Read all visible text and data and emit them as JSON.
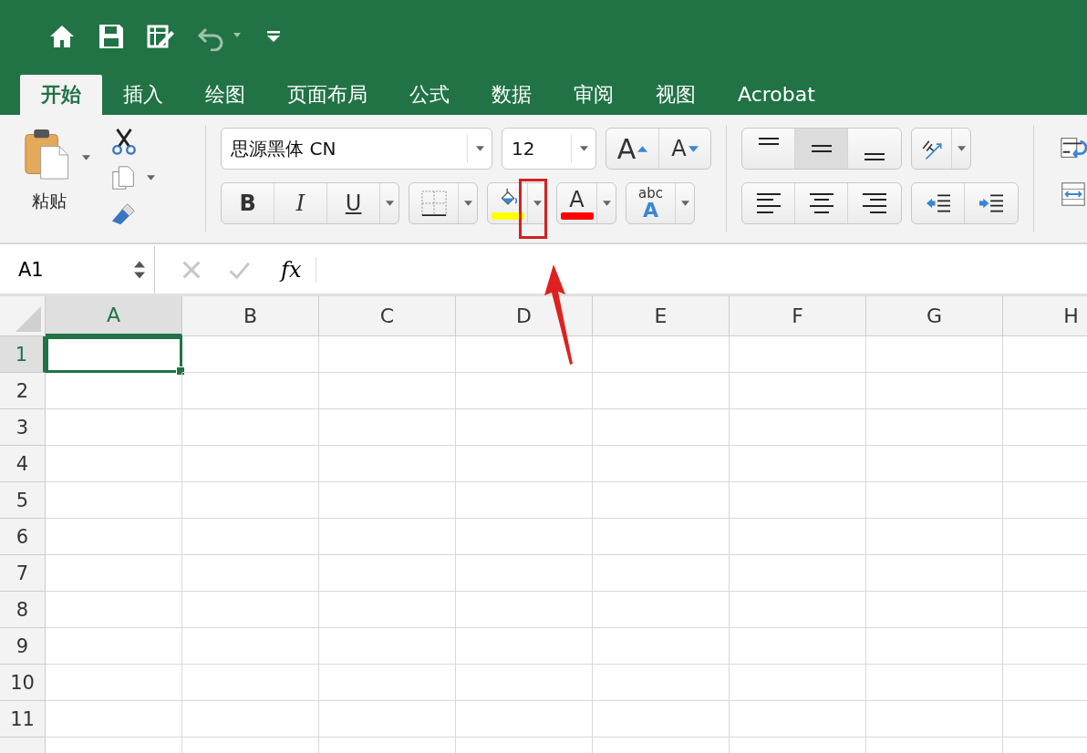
{
  "tabs": [
    {
      "label": "开始",
      "selected": true
    },
    {
      "label": "插入",
      "selected": false
    },
    {
      "label": "绘图",
      "selected": false
    },
    {
      "label": "页面布局",
      "selected": false
    },
    {
      "label": "公式",
      "selected": false
    },
    {
      "label": "数据",
      "selected": false
    },
    {
      "label": "审阅",
      "selected": false
    },
    {
      "label": "视图",
      "selected": false
    },
    {
      "label": "Acrobat",
      "selected": false
    }
  ],
  "clipboard": {
    "paste_label": "粘贴"
  },
  "font": {
    "name": "思源黑体 CN",
    "size": "12",
    "grow_label": "A",
    "shrink_label": "A",
    "bold_label": "B",
    "italic_label": "I",
    "underline_label": "U",
    "font_color_label": "A",
    "phonetic_label": "abc",
    "phonetic_sub": "A"
  },
  "vertical_align": [
    {
      "kind": "top",
      "selected": false
    },
    {
      "kind": "middle",
      "selected": true
    },
    {
      "kind": "bottom",
      "selected": false
    }
  ],
  "formula_bar": {
    "name_box": "A1",
    "fx": "fx"
  },
  "columns": [
    {
      "label": "A",
      "selected": true
    },
    {
      "label": "B",
      "selected": false
    },
    {
      "label": "C",
      "selected": false
    },
    {
      "label": "D",
      "selected": false
    },
    {
      "label": "E",
      "selected": false
    },
    {
      "label": "F",
      "selected": false
    },
    {
      "label": "G",
      "selected": false
    },
    {
      "label": "H",
      "selected": false
    }
  ],
  "rows": [
    {
      "label": "1",
      "selected": true
    },
    {
      "label": "2",
      "selected": false
    },
    {
      "label": "3",
      "selected": false
    },
    {
      "label": "4",
      "selected": false
    },
    {
      "label": "5",
      "selected": false
    },
    {
      "label": "6",
      "selected": false
    },
    {
      "label": "7",
      "selected": false
    },
    {
      "label": "8",
      "selected": false
    },
    {
      "label": "9",
      "selected": false
    },
    {
      "label": "10",
      "selected": false
    },
    {
      "label": "11",
      "selected": false
    }
  ]
}
